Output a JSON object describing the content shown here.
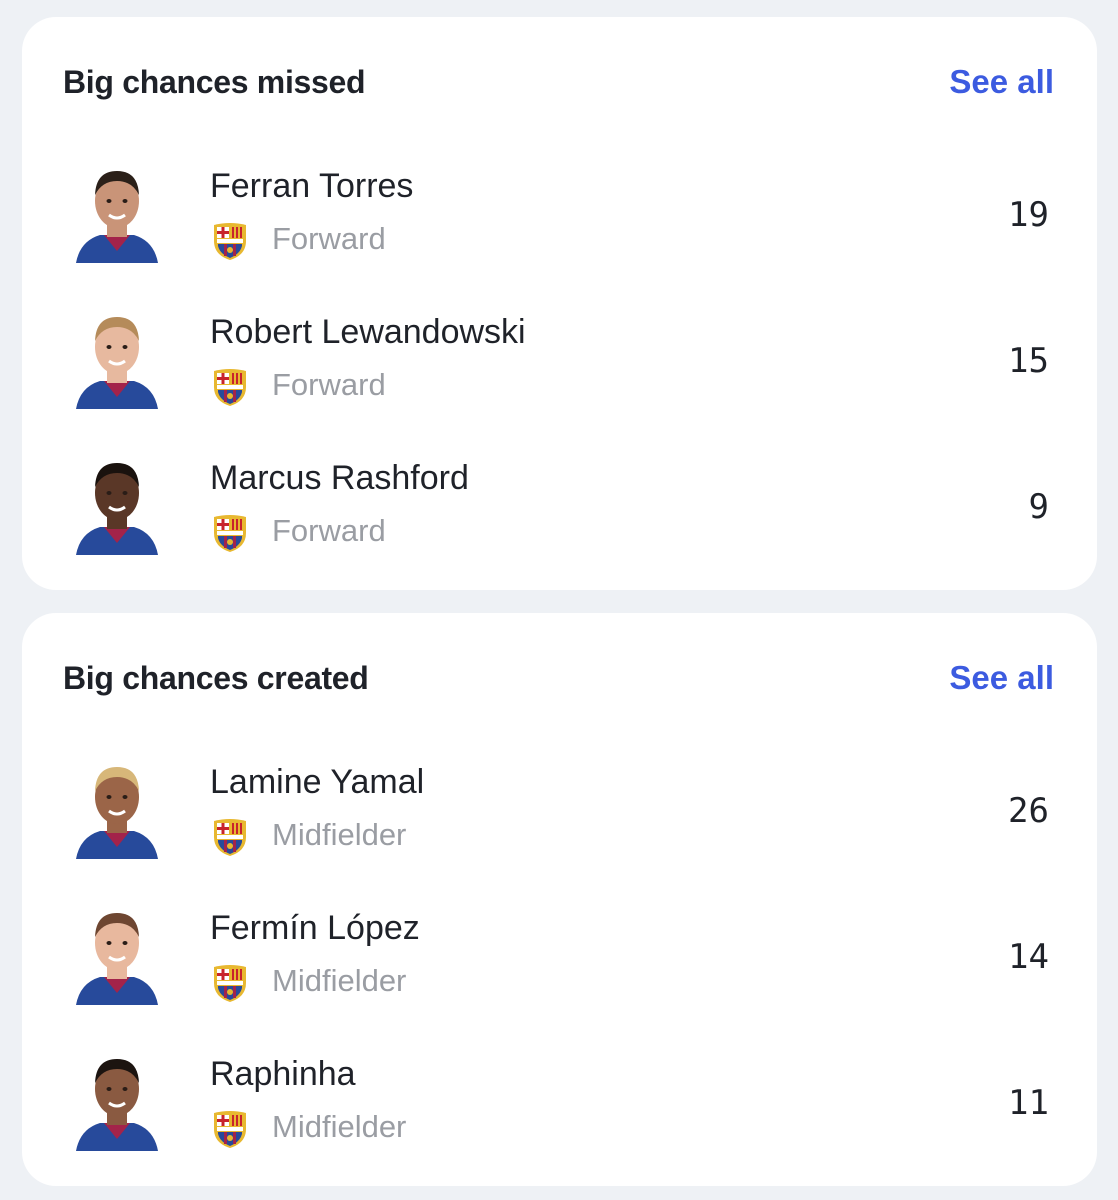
{
  "sections": [
    {
      "title": "Big chances missed",
      "see_all": "See all",
      "players": [
        {
          "name": "Ferran Torres",
          "position": "Forward",
          "value": "19",
          "skin": "#c99478",
          "hair": "#2b2019"
        },
        {
          "name": "Robert Lewandowski",
          "position": "Forward",
          "value": "15",
          "skin": "#e7b99f",
          "hair": "#b58b5a"
        },
        {
          "name": "Marcus Rashford",
          "position": "Forward",
          "value": "9",
          "skin": "#5a3727",
          "hair": "#1a120e"
        }
      ]
    },
    {
      "title": "Big chances created",
      "see_all": "See all",
      "players": [
        {
          "name": "Lamine Yamal",
          "position": "Midfielder",
          "value": "26",
          "skin": "#9b6548",
          "hair": "#d7b779"
        },
        {
          "name": "Fermín López",
          "position": "Midfielder",
          "value": "14",
          "skin": "#e8b89e",
          "hair": "#6e4631"
        },
        {
          "name": "Raphinha",
          "position": "Midfielder",
          "value": "11",
          "skin": "#8a5a41",
          "hair": "#1c1410"
        }
      ]
    }
  ],
  "colors": {
    "accent": "#3c5be0",
    "jersey": "#274a9b",
    "jersey_accent": "#a3234a",
    "crest_gold": "#e8b830"
  },
  "icons": {
    "avatar": "player-photo",
    "crest": "fc-barcelona-crest-icon"
  }
}
